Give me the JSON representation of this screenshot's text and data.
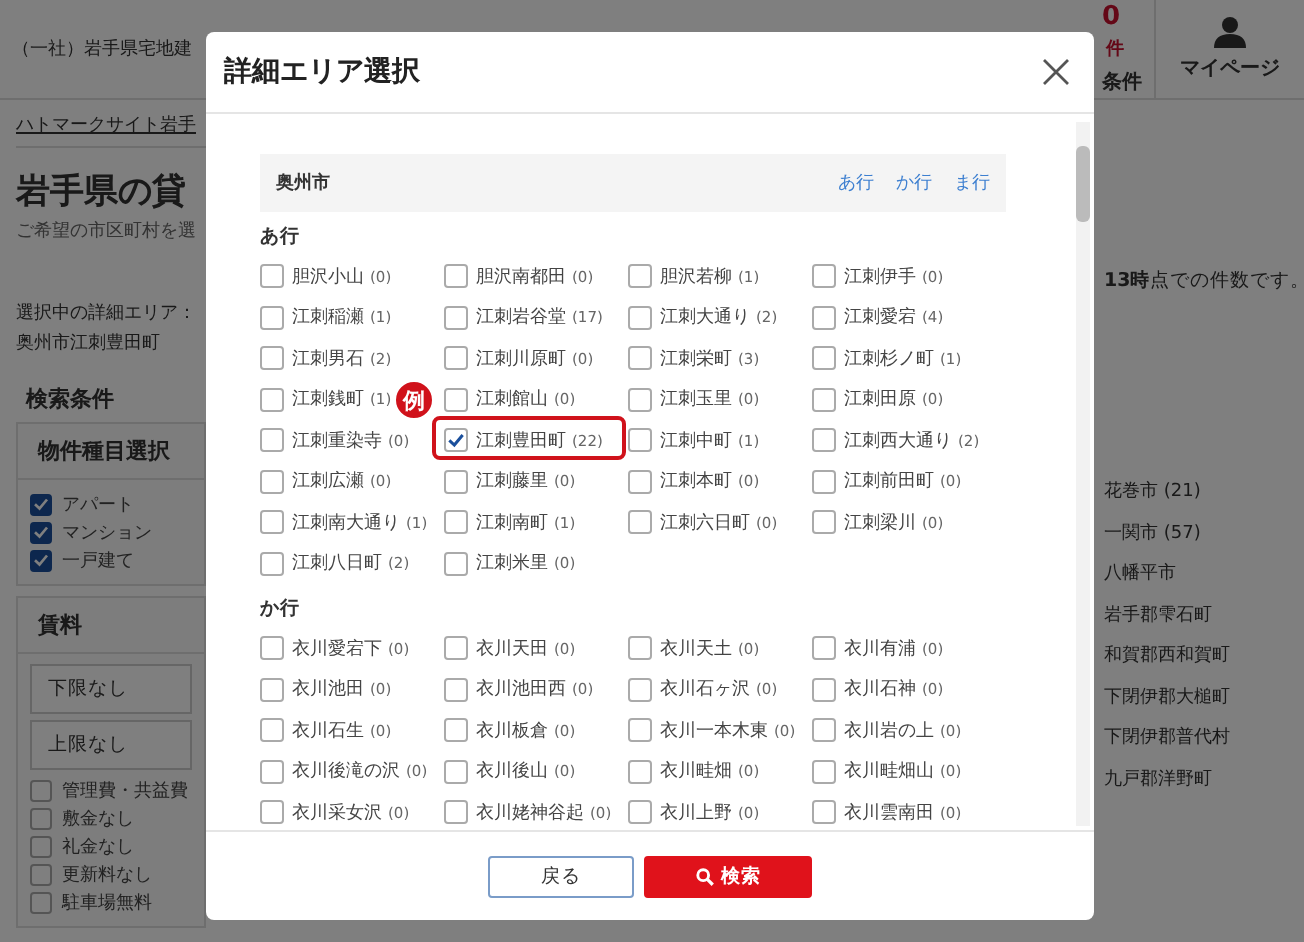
{
  "page": {
    "site_name": "（一社）岩手県宅地建",
    "header_items": [
      {
        "kind": "count",
        "number": "0",
        "unit": "件",
        "label": "条件"
      },
      {
        "kind": "account",
        "label": "マイページ"
      }
    ],
    "breadcrumb": [
      "ハトマークサイト岩手"
    ],
    "title": "岩手県の貸",
    "subtitle": "ご希望の市区町村を選",
    "selected_area_label": "選択中の詳細エリア：",
    "selected_area": "奥州市江刺豊田町",
    "conditions_heading": "検索条件",
    "property_type": {
      "heading": "物件種目選択",
      "options": [
        {
          "label": "アパート",
          "checked": true
        },
        {
          "label": "マンション",
          "checked": true
        },
        {
          "label": "一戸建て",
          "checked": true
        }
      ]
    },
    "rent": {
      "heading": "賃料",
      "selects": [
        "下限なし",
        "上限なし"
      ],
      "options": [
        {
          "label": "管理費・共益費",
          "checked": false
        },
        {
          "label": "敷金なし",
          "checked": false
        },
        {
          "label": "礼金なし",
          "checked": false
        },
        {
          "label": "更新料なし",
          "checked": false
        },
        {
          "label": "駐車場無料",
          "checked": false
        }
      ]
    },
    "note": "**13時**点での件数です。",
    "cities": [
      "花巻市 (21)",
      "一関市 (57)",
      "八幡平市",
      "岩手郡雫石町",
      "和賀郡西和賀町",
      "下閉伊郡大槌町",
      "下閉伊郡普代村",
      "九戸郡洋野町"
    ]
  },
  "modal": {
    "title": "詳細エリア選択",
    "city": "奥州市",
    "index_links": [
      "あ行",
      "か行",
      "ま行"
    ],
    "annotation": "例",
    "groups": [
      {
        "heading": "あ行",
        "items": [
          {
            "name": "胆沢小山",
            "count": "(0)",
            "checked": false,
            "highlighted": false
          },
          {
            "name": "胆沢南都田",
            "count": "(0)",
            "checked": false,
            "highlighted": false
          },
          {
            "name": "胆沢若柳",
            "count": "(1)",
            "checked": false,
            "highlighted": false
          },
          {
            "name": "江刺伊手",
            "count": "(0)",
            "checked": false,
            "highlighted": false
          },
          {
            "name": "江刺稲瀬",
            "count": "(1)",
            "checked": false,
            "highlighted": false
          },
          {
            "name": "江刺岩谷堂",
            "count": "(17)",
            "checked": false,
            "highlighted": false
          },
          {
            "name": "江刺大通り",
            "count": "(2)",
            "checked": false,
            "highlighted": false
          },
          {
            "name": "江刺愛宕",
            "count": "(4)",
            "checked": false,
            "highlighted": false
          },
          {
            "name": "江刺男石",
            "count": "(2)",
            "checked": false,
            "highlighted": false
          },
          {
            "name": "江刺川原町",
            "count": "(0)",
            "checked": false,
            "highlighted": false
          },
          {
            "name": "江刺栄町",
            "count": "(3)",
            "checked": false,
            "highlighted": false
          },
          {
            "name": "江刺杉ノ町",
            "count": "(1)",
            "checked": false,
            "highlighted": false
          },
          {
            "name": "江刺銭町",
            "count": "(1)",
            "checked": false,
            "highlighted": false
          },
          {
            "name": "江刺館山",
            "count": "(0)",
            "checked": false,
            "highlighted": false
          },
          {
            "name": "江刺玉里",
            "count": "(0)",
            "checked": false,
            "highlighted": false
          },
          {
            "name": "江刺田原",
            "count": "(0)",
            "checked": false,
            "highlighted": false
          },
          {
            "name": "江刺重染寺",
            "count": "(0)",
            "checked": false,
            "highlighted": false
          },
          {
            "name": "江刺豊田町",
            "count": "(22)",
            "checked": true,
            "highlighted": true
          },
          {
            "name": "江刺中町",
            "count": "(1)",
            "checked": false,
            "highlighted": false
          },
          {
            "name": "江刺西大通り",
            "count": "(2)",
            "checked": false,
            "highlighted": false
          },
          {
            "name": "江刺広瀬",
            "count": "(0)",
            "checked": false,
            "highlighted": false
          },
          {
            "name": "江刺藤里",
            "count": "(0)",
            "checked": false,
            "highlighted": false
          },
          {
            "name": "江刺本町",
            "count": "(0)",
            "checked": false,
            "highlighted": false
          },
          {
            "name": "江刺前田町",
            "count": "(0)",
            "checked": false,
            "highlighted": false
          },
          {
            "name": "江刺南大通り",
            "count": "(1)",
            "checked": false,
            "highlighted": false
          },
          {
            "name": "江刺南町",
            "count": "(1)",
            "checked": false,
            "highlighted": false
          },
          {
            "name": "江刺六日町",
            "count": "(0)",
            "checked": false,
            "highlighted": false
          },
          {
            "name": "江刺梁川",
            "count": "(0)",
            "checked": false,
            "highlighted": false
          },
          {
            "name": "江刺八日町",
            "count": "(2)",
            "checked": false,
            "highlighted": false
          },
          {
            "name": "江刺米里",
            "count": "(0)",
            "checked": false,
            "highlighted": false
          }
        ]
      },
      {
        "heading": "か行",
        "items": [
          {
            "name": "衣川愛宕下",
            "count": "(0)",
            "checked": false,
            "highlighted": false
          },
          {
            "name": "衣川天田",
            "count": "(0)",
            "checked": false,
            "highlighted": false
          },
          {
            "name": "衣川天土",
            "count": "(0)",
            "checked": false,
            "highlighted": false
          },
          {
            "name": "衣川有浦",
            "count": "(0)",
            "checked": false,
            "highlighted": false
          },
          {
            "name": "衣川池田",
            "count": "(0)",
            "checked": false,
            "highlighted": false
          },
          {
            "name": "衣川池田西",
            "count": "(0)",
            "checked": false,
            "highlighted": false
          },
          {
            "name": "衣川石ヶ沢",
            "count": "(0)",
            "checked": false,
            "highlighted": false
          },
          {
            "name": "衣川石神",
            "count": "(0)",
            "checked": false,
            "highlighted": false
          },
          {
            "name": "衣川石生",
            "count": "(0)",
            "checked": false,
            "highlighted": false
          },
          {
            "name": "衣川板倉",
            "count": "(0)",
            "checked": false,
            "highlighted": false
          },
          {
            "name": "衣川一本木東",
            "count": "(0)",
            "checked": false,
            "highlighted": false
          },
          {
            "name": "衣川岩の上",
            "count": "(0)",
            "checked": false,
            "highlighted": false
          },
          {
            "name": "衣川後滝の沢",
            "count": "(0)",
            "checked": false,
            "highlighted": false
          },
          {
            "name": "衣川後山",
            "count": "(0)",
            "checked": false,
            "highlighted": false
          },
          {
            "name": "衣川畦畑",
            "count": "(0)",
            "checked": false,
            "highlighted": false
          },
          {
            "name": "衣川畦畑山",
            "count": "(0)",
            "checked": false,
            "highlighted": false
          },
          {
            "name": "衣川采女沢",
            "count": "(0)",
            "checked": false,
            "highlighted": false
          },
          {
            "name": "衣川姥神谷起",
            "count": "(0)",
            "checked": false,
            "highlighted": false
          },
          {
            "name": "衣川上野",
            "count": "(0)",
            "checked": false,
            "highlighted": false
          },
          {
            "name": "衣川雲南田",
            "count": "(0)",
            "checked": false,
            "highlighted": false
          }
        ]
      }
    ],
    "buttons": [
      {
        "kind": "secondary",
        "label": "戻る"
      },
      {
        "kind": "primary",
        "label": "検索"
      }
    ]
  }
}
